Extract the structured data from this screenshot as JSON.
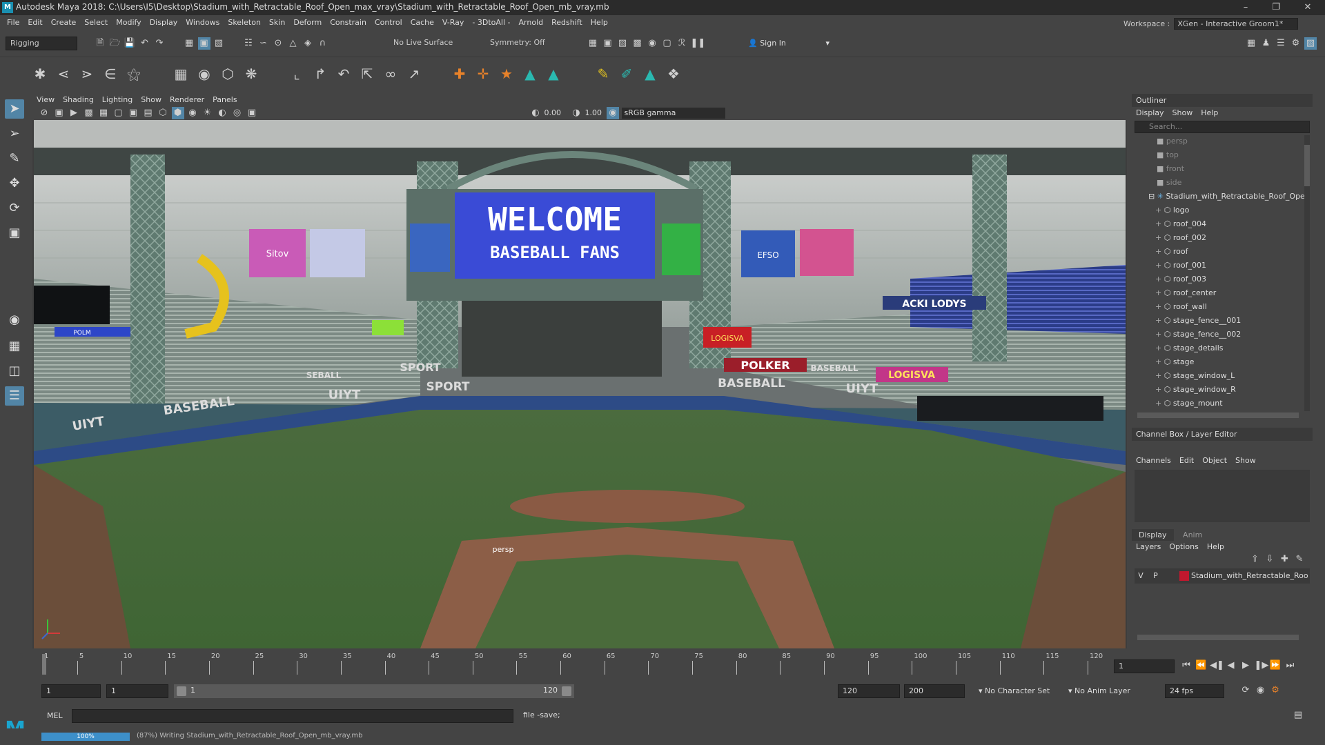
{
  "window": {
    "title": "Autodesk Maya 2018: C:\\Users\\I5\\Desktop\\Stadium_with_Retractable_Roof_Open_max_vray\\Stadium_with_Retractable_Roof_Open_mb_vray.mb",
    "logo": "M"
  },
  "menubar": {
    "items": [
      "File",
      "Edit",
      "Create",
      "Select",
      "Modify",
      "Display",
      "Windows",
      "Skeleton",
      "Skin",
      "Deform",
      "Constrain",
      "Control",
      "Cache",
      "V-Ray",
      "- 3DtoAll -",
      "Arnold",
      "Redshift",
      "Help"
    ],
    "workspace_label": "Workspace :",
    "workspace_value": "XGen - Interactive Groom1*"
  },
  "statusline": {
    "menuset": "Rigging",
    "live_surface": "No Live Surface",
    "symmetry": "Symmetry: Off",
    "sign_in": "Sign In"
  },
  "viewport": {
    "menus": [
      "View",
      "Shading",
      "Lighting",
      "Show",
      "Renderer",
      "Panels"
    ],
    "exposure": "0.00",
    "gamma": "1.00",
    "colorspace": "sRGB gamma",
    "camera_label": "persp",
    "screen": {
      "line1": "WELCOME",
      "line2": "BASEBALL FANS"
    },
    "banners": [
      "BASEBALL",
      "SPORT",
      "UIYT",
      "SPORT",
      "BASEBALL",
      "UIYT",
      "POLKER",
      "BASEBALL",
      "LOGISVA",
      "ACKI LODYS",
      "SEBALL",
      "UIYT",
      "Sitov",
      "EFSO",
      "LOGISVA",
      "POLM"
    ]
  },
  "outliner": {
    "title": "Outliner",
    "menus": [
      "Display",
      "Show",
      "Help"
    ],
    "search_placeholder": "Search...",
    "cameras": [
      "persp",
      "top",
      "front",
      "side"
    ],
    "root": "Stadium_with_Retractable_Roof_Ope",
    "children": [
      "logo",
      "roof_004",
      "roof_002",
      "roof",
      "roof_001",
      "roof_003",
      "roof_center",
      "roof_wall",
      "stage_fence__001",
      "stage_fence__002",
      "stage_details",
      "stage",
      "stage_window_L",
      "stage_window_R",
      "stage_mount"
    ]
  },
  "channelbox": {
    "title": "Channel Box / Layer Editor",
    "menus": [
      "Channels",
      "Edit",
      "Object",
      "Show"
    ],
    "tabs": [
      "Display",
      "Anim"
    ],
    "layer_menus": [
      "Layers",
      "Options",
      "Help"
    ],
    "layer_v": "V",
    "layer_p": "P",
    "layer_name": "Stadium_with_Retractable_Roo",
    "layer_color": "#c0182e"
  },
  "timeslider": {
    "ticks": [
      "1",
      "5",
      "10",
      "15",
      "20",
      "25",
      "30",
      "35",
      "40",
      "45",
      "50",
      "55",
      "60",
      "65",
      "70",
      "75",
      "80",
      "85",
      "90",
      "95",
      "100",
      "105",
      "110",
      "115",
      "120"
    ],
    "current_frame": "1"
  },
  "range": {
    "start": "1",
    "playback_start": "1",
    "slider_start": "1",
    "slider_end": "120",
    "playback_end": "120",
    "end": "200",
    "character_set": "No Character Set",
    "anim_layer": "No Anim Layer",
    "fps": "24 fps"
  },
  "cmdline": {
    "mode": "MEL",
    "output": "file -save;"
  },
  "helpline": {
    "progress_label": "100%",
    "progress": 1.0,
    "message": "(87%) Writing Stadium_with_Retractable_Roof_Open_mb_vray.mb"
  }
}
